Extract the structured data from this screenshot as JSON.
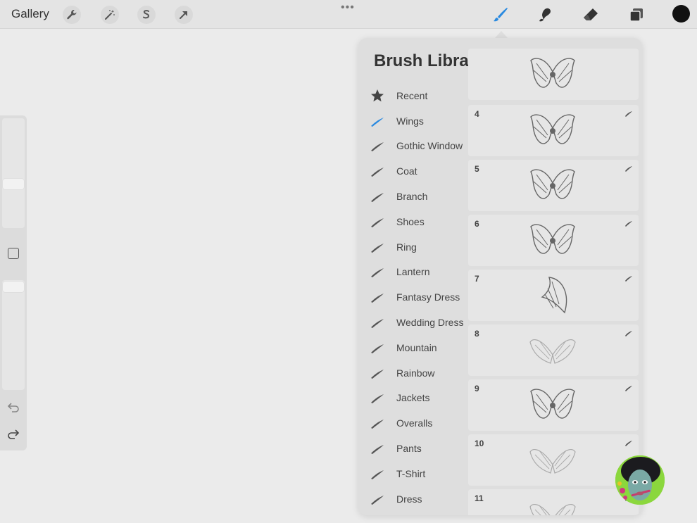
{
  "topbar": {
    "gallery_label": "Gallery",
    "left_icons": [
      "wrench-icon",
      "magic-wand-icon",
      "selection-icon",
      "transform-arrow-icon"
    ],
    "right_icons": [
      "brush-icon",
      "smudge-icon",
      "eraser-icon",
      "layers-icon"
    ],
    "active_tool": "brush-icon",
    "accent_color": "#2a8ae0",
    "current_color": "#111111"
  },
  "panel": {
    "title": "Brush Library",
    "sets": [
      {
        "label": "Recent",
        "icon": "star-icon"
      },
      {
        "label": "Wings",
        "icon": "brush-stroke-icon",
        "selected": true
      },
      {
        "label": "Gothic Window",
        "icon": "brush-stroke-icon"
      },
      {
        "label": "Coat",
        "icon": "brush-stroke-icon"
      },
      {
        "label": "Branch",
        "icon": "brush-stroke-icon"
      },
      {
        "label": "Shoes",
        "icon": "brush-stroke-icon"
      },
      {
        "label": "Ring",
        "icon": "brush-stroke-icon"
      },
      {
        "label": "Lantern",
        "icon": "brush-stroke-icon"
      },
      {
        "label": "Fantasy Dress",
        "icon": "brush-stroke-icon"
      },
      {
        "label": "Wedding Dress",
        "icon": "brush-stroke-icon"
      },
      {
        "label": "Mountain",
        "icon": "brush-stroke-icon"
      },
      {
        "label": "Rainbow",
        "icon": "brush-stroke-icon"
      },
      {
        "label": "Jackets",
        "icon": "brush-stroke-icon"
      },
      {
        "label": "Overalls",
        "icon": "brush-stroke-icon"
      },
      {
        "label": "Pants",
        "icon": "brush-stroke-icon"
      },
      {
        "label": "T-Shirt",
        "icon": "brush-stroke-icon"
      },
      {
        "label": "Dress",
        "icon": "brush-stroke-icon"
      }
    ],
    "brushes": [
      {
        "label": "",
        "partial": true
      },
      {
        "label": "4"
      },
      {
        "label": "5"
      },
      {
        "label": "6"
      },
      {
        "label": "7"
      },
      {
        "label": "8"
      },
      {
        "label": "9"
      },
      {
        "label": "10"
      },
      {
        "label": "11"
      }
    ]
  }
}
